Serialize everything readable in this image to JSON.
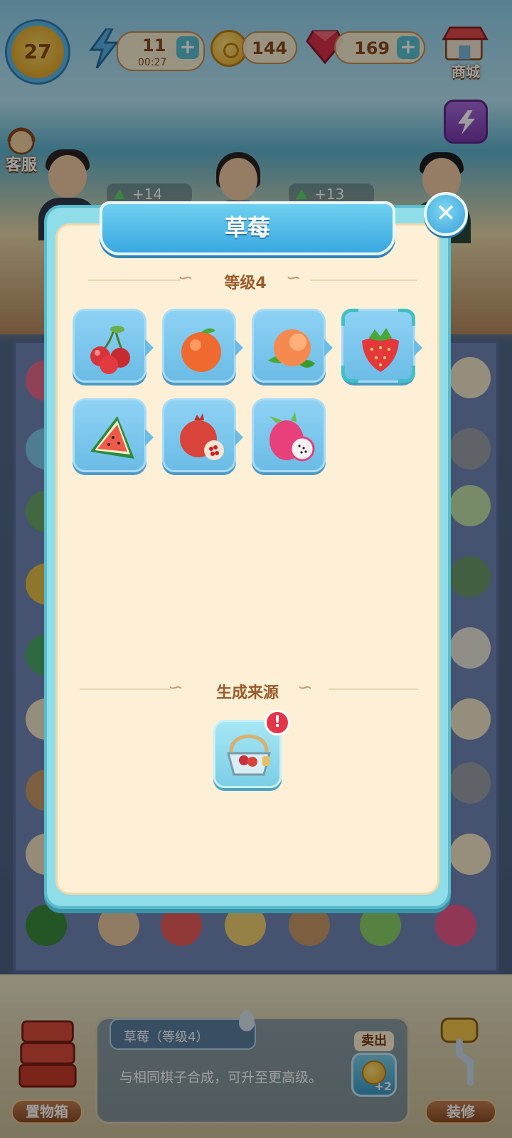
{
  "hud": {
    "level": "27",
    "energy": {
      "value": "11",
      "timer": "00:27"
    },
    "coins": "144",
    "gems": "169",
    "shop_label": "商城",
    "service_label": "客服"
  },
  "background": {
    "bubbles": [
      "+14",
      "+13"
    ]
  },
  "modal": {
    "title": "草莓",
    "level_heading": "等级4",
    "chain_items": [
      {
        "name": "cherry-icon",
        "selected": false
      },
      {
        "name": "orange-icon",
        "selected": false
      },
      {
        "name": "peach-icon",
        "selected": false
      },
      {
        "name": "strawberry-icon",
        "selected": true
      },
      {
        "name": "watermelon-icon",
        "selected": false
      },
      {
        "name": "pomegranate-icon",
        "selected": false
      },
      {
        "name": "dragon-fruit-icon",
        "selected": false
      }
    ],
    "source_heading": "生成来源",
    "source_item": "fruit-basket-icon",
    "alert": "!"
  },
  "bottom": {
    "storage_label": "置物箱",
    "item_title": "草莓（等级4）",
    "item_desc": "与相同棋子合成，可升至更高级。",
    "sell_label": "卖出",
    "sell_amount": "+2",
    "decorate_label": "装修"
  },
  "colors": {
    "modal_frame": "#8fdde8",
    "modal_body": "#fdf0d6",
    "title_banner": "#3aa8e0",
    "tile": "#6bbce6",
    "alert": "#e4354a"
  }
}
